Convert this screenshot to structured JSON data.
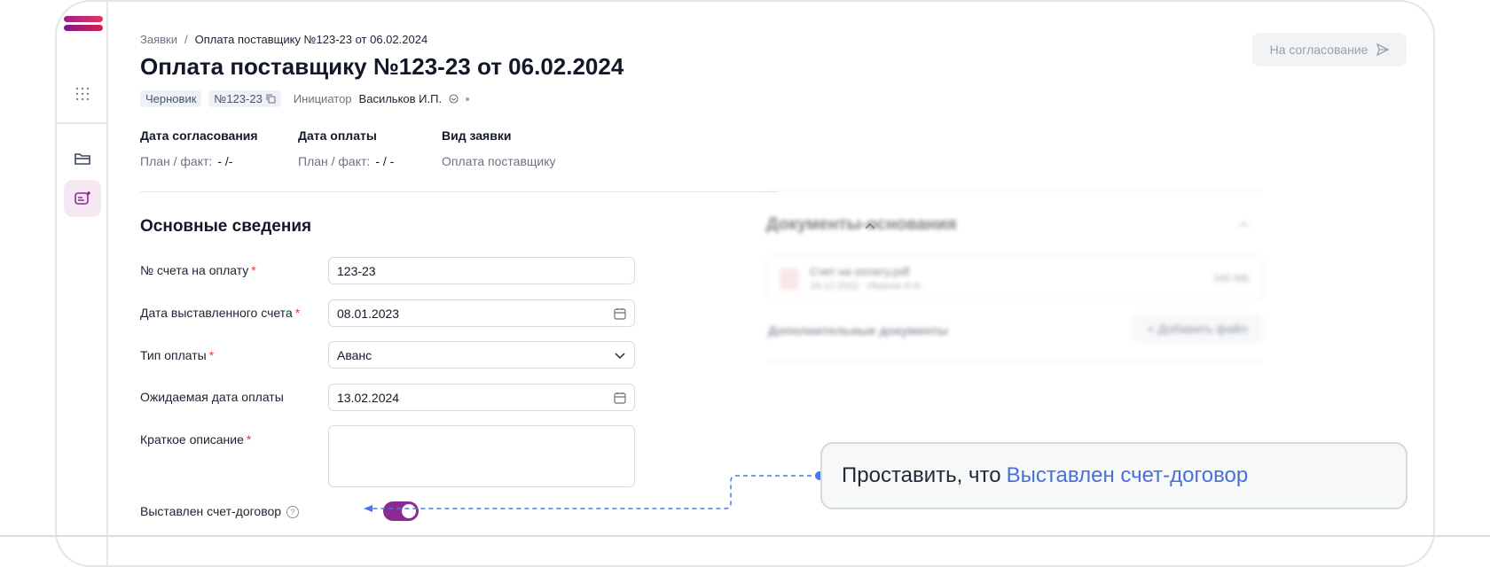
{
  "breadcrumb": {
    "root": "Заявки",
    "separator": "/",
    "current": "Оплата поставщику №123-23 от 06.02.2024"
  },
  "header": {
    "title": "Оплата поставщику №123-23 от 06.02.2024",
    "status_tag": "Черновик",
    "number_tag": "№123-23",
    "initiator_label": "Инициатор",
    "initiator_name": "Васильков И.П.",
    "approve_button": "На согласование"
  },
  "info": {
    "approval_date": {
      "label": "Дата согласования",
      "plan_fact": "План / факт:",
      "value": "- /-"
    },
    "payment_date": {
      "label": "Дата оплаты",
      "plan_fact": "План / факт:",
      "value": "- / -"
    },
    "request_type": {
      "label": "Вид заявки",
      "value": "Оплата поставщику"
    }
  },
  "main_section": {
    "title": "Основные сведения",
    "fields": {
      "invoice_number": {
        "label": "№ счета на оплату",
        "value": "123-23",
        "required": "*"
      },
      "invoice_date": {
        "label": "Дата выставленного счета",
        "value": "08.01.2023",
        "required": "*"
      },
      "payment_type": {
        "label": "Тип оплаты",
        "value": "Аванс",
        "required": "*"
      },
      "expected_date": {
        "label": "Ожидаемая дата оплаты",
        "value": "13.02.2024"
      },
      "description": {
        "label": "Краткое описание",
        "required": "*"
      },
      "invoice_contract": {
        "label": "Выставлен счет-договор",
        "help": "?",
        "checked": true
      }
    }
  },
  "documents_section": {
    "title": "Документы-основания",
    "file": {
      "name": "Счет на оплату.pdf",
      "meta": "18.12.2022 · Иванов И.И.",
      "size": "345 МБ"
    },
    "additional_label": "Дополнительные документы",
    "add_button": "+ Добавить файл"
  },
  "tooltip": {
    "prefix": "Проставить, что",
    "highlight": "Выставлен счет-договор"
  },
  "colors": {
    "accent": "#8b2a8f",
    "link": "#4a6fd8",
    "required": "#e53935"
  }
}
